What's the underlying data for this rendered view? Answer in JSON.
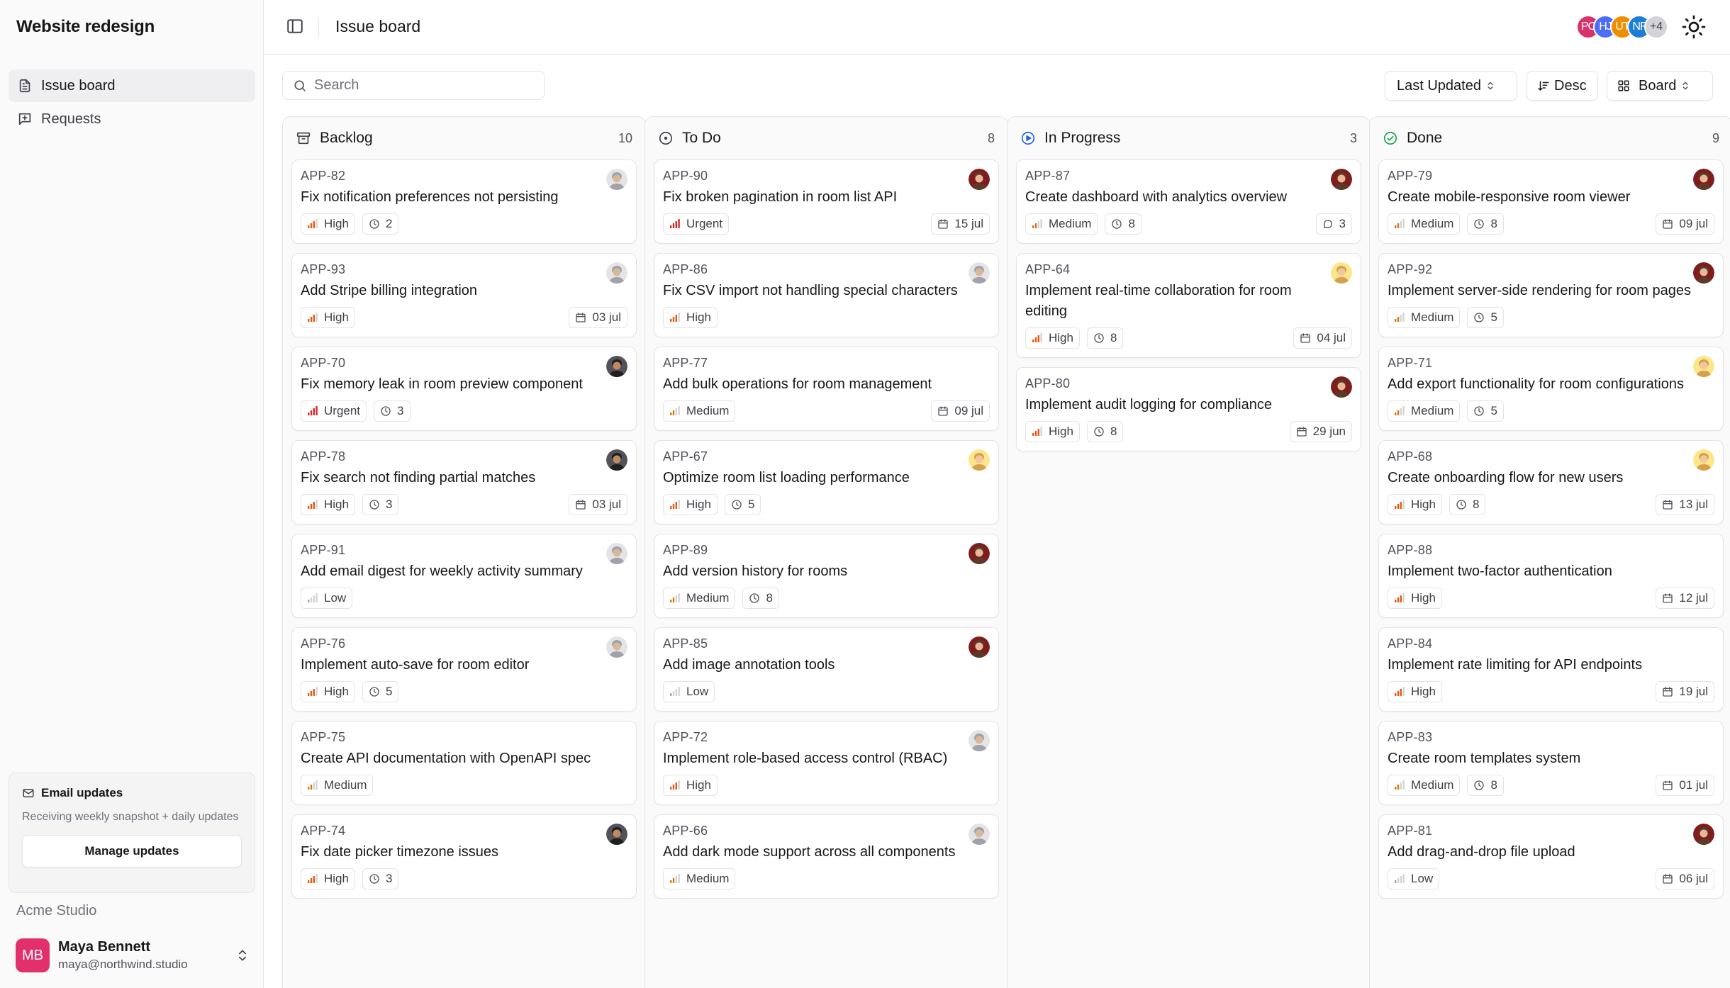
{
  "sidebar": {
    "workspace": "Website redesign",
    "nav": [
      {
        "label": "Issue board",
        "icon": "document-icon",
        "active": true
      },
      {
        "label": "Requests",
        "icon": "message-plus-icon",
        "active": false
      }
    ],
    "email_card": {
      "title": "Email updates",
      "description": "Receiving weekly snapshot + daily updates",
      "button": "Manage updates"
    },
    "org": "Acme Studio",
    "user": {
      "initials": "MB",
      "name": "Maya Bennett",
      "email": "maya@northwind.studio",
      "color": "#e1306c"
    }
  },
  "header": {
    "title": "Issue board",
    "avatars": [
      {
        "initials": "PC",
        "color": "#d6336c"
      },
      {
        "initials": "HJ",
        "color": "#4c6ef5"
      },
      {
        "initials": "UT",
        "color": "#f08c00"
      },
      {
        "initials": "NF",
        "color": "#1c7ed6"
      },
      {
        "initials": "+4",
        "color": "#d4d4d8"
      }
    ]
  },
  "toolbar": {
    "search_placeholder": "Search",
    "sort": "Last Updated",
    "order": "Desc",
    "view": "Board"
  },
  "colors": {
    "urgent": "#dc2626",
    "high": "#ea580c",
    "medium": "#d97706",
    "low": "#a1a1aa",
    "in_progress": "#2563eb",
    "done": "#16a34a"
  },
  "columns": [
    {
      "title": "Backlog",
      "count": "10",
      "icon": "archive-icon",
      "cards": [
        {
          "id": "APP-82",
          "title": "Fix notification preferences not persisting",
          "priority": "High",
          "estimate": "2",
          "avatar": "gray"
        },
        {
          "id": "APP-93",
          "title": "Add Stripe billing integration",
          "priority": "High",
          "date": "03 jul",
          "avatar": "gray"
        },
        {
          "id": "APP-70",
          "title": "Fix memory leak in room preview component",
          "priority": "Urgent",
          "estimate": "3",
          "avatar": "dark"
        },
        {
          "id": "APP-78",
          "title": "Fix search not finding partial matches",
          "priority": "High",
          "estimate": "3",
          "date": "03 jul",
          "avatar": "dark"
        },
        {
          "id": "APP-91",
          "title": "Add email digest for weekly activity summary",
          "priority": "Low",
          "avatar": "gray"
        },
        {
          "id": "APP-76",
          "title": "Implement auto-save for room editor",
          "priority": "High",
          "estimate": "5",
          "avatar": "gray"
        },
        {
          "id": "APP-75",
          "title": "Create API documentation with OpenAPI spec",
          "priority": "Medium"
        },
        {
          "id": "APP-74",
          "title": "Fix date picker timezone issues",
          "priority": "High",
          "estimate": "3",
          "avatar": "dark"
        }
      ]
    },
    {
      "title": "To Do",
      "count": "8",
      "icon": "circle-icon",
      "cards": [
        {
          "id": "APP-90",
          "title": "Fix broken pagination in room list API",
          "priority": "Urgent",
          "date": "15 jul",
          "avatar": "red"
        },
        {
          "id": "APP-86",
          "title": "Fix CSV import not handling special characters",
          "priority": "High",
          "avatar": "gray"
        },
        {
          "id": "APP-77",
          "title": "Add bulk operations for room management",
          "priority": "Medium",
          "date": "09 jul"
        },
        {
          "id": "APP-67",
          "title": "Optimize room list loading performance",
          "priority": "High",
          "estimate": "5",
          "avatar": "blonde"
        },
        {
          "id": "APP-89",
          "title": "Add version history for rooms",
          "priority": "Medium",
          "estimate": "8",
          "avatar": "red"
        },
        {
          "id": "APP-85",
          "title": "Add image annotation tools",
          "priority": "Low",
          "avatar": "red"
        },
        {
          "id": "APP-72",
          "title": "Implement role-based access control (RBAC)",
          "priority": "High",
          "avatar": "gray"
        },
        {
          "id": "APP-66",
          "title": "Add dark mode support across all components",
          "priority": "Medium",
          "avatar": "gray"
        }
      ]
    },
    {
      "title": "In Progress",
      "count": "3",
      "icon": "play-circle-icon",
      "cards": [
        {
          "id": "APP-87",
          "title": "Create dashboard with analytics overview",
          "priority": "Medium",
          "estimate": "8",
          "comments": "3",
          "avatar": "red"
        },
        {
          "id": "APP-64",
          "title": "Implement real-time collaboration for room editing",
          "priority": "High",
          "estimate": "8",
          "date": "04 jul",
          "avatar": "blonde"
        },
        {
          "id": "APP-80",
          "title": "Implement audit logging for compliance",
          "priority": "High",
          "estimate": "8",
          "date": "29 jun",
          "avatar": "red"
        }
      ]
    },
    {
      "title": "Done",
      "count": "9",
      "icon": "check-circle-icon",
      "cards": [
        {
          "id": "APP-79",
          "title": "Create mobile-responsive room viewer",
          "priority": "Medium",
          "estimate": "8",
          "date": "09 jul",
          "avatar": "red"
        },
        {
          "id": "APP-92",
          "title": "Implement server-side rendering for room pages",
          "priority": "Medium",
          "estimate": "5",
          "avatar": "red"
        },
        {
          "id": "APP-71",
          "title": "Add export functionality for room configurations",
          "priority": "Medium",
          "estimate": "5",
          "avatar": "blonde"
        },
        {
          "id": "APP-68",
          "title": "Create onboarding flow for new users",
          "priority": "High",
          "estimate": "8",
          "date": "13 jul",
          "avatar": "blonde"
        },
        {
          "id": "APP-88",
          "title": "Implement two-factor authentication",
          "priority": "High",
          "date": "12 jul"
        },
        {
          "id": "APP-84",
          "title": "Implement rate limiting for API endpoints",
          "priority": "High",
          "date": "19 jul"
        },
        {
          "id": "APP-83",
          "title": "Create room templates system",
          "priority": "Medium",
          "estimate": "8",
          "date": "01 jul"
        },
        {
          "id": "APP-81",
          "title": "Add drag-and-drop file upload",
          "priority": "Low",
          "date": "06 jul",
          "avatar": "red"
        }
      ]
    }
  ]
}
